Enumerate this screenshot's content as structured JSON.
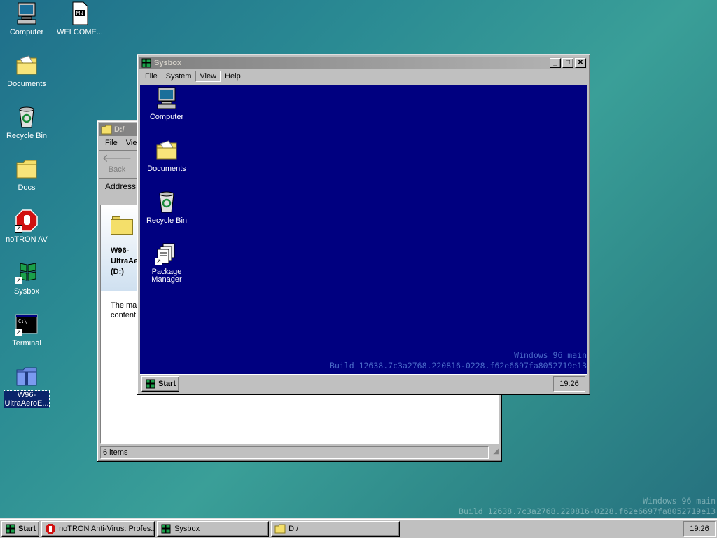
{
  "desktop": {
    "icons": [
      {
        "label": "Computer"
      },
      {
        "label": "WELCOME..."
      },
      {
        "label": "Documents"
      },
      {
        "label": "Recycle Bin"
      },
      {
        "label": "Docs"
      },
      {
        "label": "noTRON AV"
      },
      {
        "label": "Sysbox"
      },
      {
        "label": "Terminal"
      },
      {
        "label": "W96-\nUltraAeroE..."
      }
    ],
    "watermark": {
      "line1": "Windows 96 main",
      "line2": "Build 12638.7c3a2768.220816-0228.f62e6697fa8052719e13"
    }
  },
  "explorer": {
    "title": "D:/",
    "menu": [
      "File",
      "View"
    ],
    "back_label": "Back",
    "address_label": "Address",
    "drive_title": "W96-\nUltraAe\n(D:)",
    "description": "The mai\ncontent",
    "status": "6 items"
  },
  "sysbox": {
    "title": "Sysbox",
    "menu": [
      "File",
      "System",
      "View",
      "Help"
    ],
    "icons": [
      {
        "label": "Computer"
      },
      {
        "label": "Documents"
      },
      {
        "label": "Recycle Bin"
      },
      {
        "label": "Package\nManager"
      }
    ],
    "watermark": {
      "line1": "Windows 96 main",
      "line2": "Build 12638.7c3a2768.220816-0228.f62e6697fa8052719e13"
    },
    "taskbar": {
      "start": "Start",
      "clock": "19:26"
    },
    "colors": {
      "desktop": "#000080"
    }
  },
  "taskbar": {
    "start": "Start",
    "tasks": [
      {
        "label": "noTRON Anti-Virus: Profes..."
      },
      {
        "label": "Sysbox"
      },
      {
        "label": "D:/"
      }
    ],
    "clock": "19:26"
  },
  "colors": {
    "titlebar_active": "#000080",
    "selection": "#0a246a",
    "window_face": "#c0c0c0"
  }
}
